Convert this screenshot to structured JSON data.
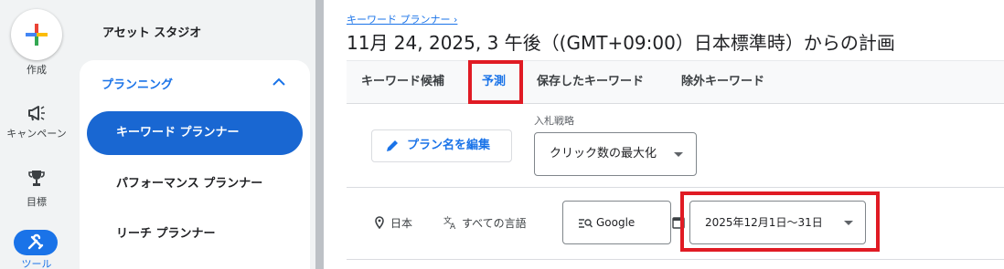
{
  "rail": {
    "create_label": "作成",
    "campaign_label": "キャンペーン",
    "goals_label": "目標",
    "tools_label": "ツール"
  },
  "subnav": {
    "asset_studio": "アセット スタジオ",
    "planning_header": "プランニング",
    "items": [
      {
        "label": "キーワード プランナー",
        "active": true
      },
      {
        "label": "パフォーマンス プランナー",
        "active": false
      },
      {
        "label": "リーチ プランナー",
        "active": false
      }
    ]
  },
  "main": {
    "breadcrumb": "キーワード プランナー",
    "title": "11月 24, 2025, 3 午後（(GMT+09:00）日本標準時）からの計画",
    "tabs": [
      {
        "label": "キーワード候補",
        "active": false
      },
      {
        "label": "予測",
        "active": true
      },
      {
        "label": "保存したキーワード",
        "active": false
      },
      {
        "label": "除外キーワード",
        "active": false
      }
    ],
    "edit_plan_name": "プラン名を編集",
    "bid_strategy_label": "入札戦略",
    "bid_strategy_value": "クリック数の最大化",
    "location": "日本",
    "language": "すべての言語",
    "network": "Google",
    "date_range": "2025年12月1日〜31日"
  },
  "colors": {
    "accent": "#1a73e8",
    "active_nav": "#1967d2",
    "highlight": "#e01b24"
  },
  "icons": [
    "google-plus-icon",
    "megaphone-icon",
    "trophy-icon",
    "tools-icon",
    "chevron-up-icon",
    "pencil-icon",
    "location-pin-icon",
    "translate-icon",
    "search-network-icon",
    "calendar-icon",
    "dropdown-arrow-icon"
  ]
}
